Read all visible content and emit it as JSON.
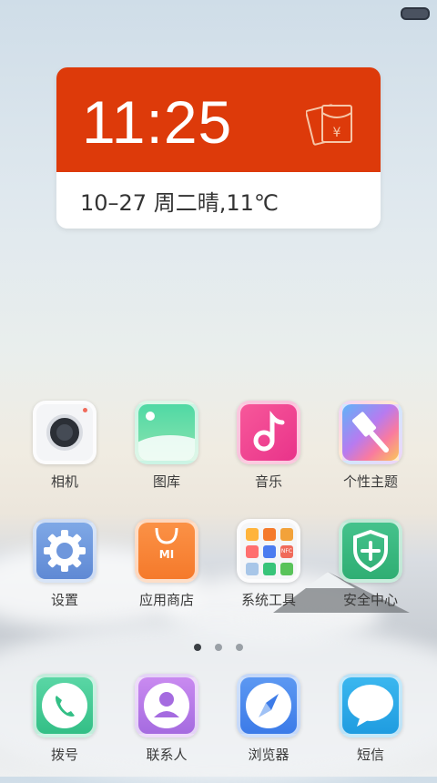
{
  "widget": {
    "time": "11:25",
    "date_weather": "10–27 周二晴,11℃",
    "currency_symbol": "¥"
  },
  "apps_row1": [
    {
      "label": "相机",
      "icon": "camera-icon"
    },
    {
      "label": "图库",
      "icon": "gallery-icon"
    },
    {
      "label": "音乐",
      "icon": "music-icon"
    },
    {
      "label": "个性主题",
      "icon": "theme-brush-icon"
    }
  ],
  "apps_row2": [
    {
      "label": "设置",
      "icon": "gear-icon"
    },
    {
      "label": "应用商店",
      "icon": "app-store-bag-icon",
      "logo_text": "MI"
    },
    {
      "label": "系统工具",
      "icon": "folder-icon",
      "folder_badge": "NFC"
    },
    {
      "label": "安全中心",
      "icon": "shield-plus-icon"
    }
  ],
  "dock": [
    {
      "label": "拨号",
      "icon": "phone-icon"
    },
    {
      "label": "联系人",
      "icon": "contact-icon"
    },
    {
      "label": "浏览器",
      "icon": "compass-icon"
    },
    {
      "label": "短信",
      "icon": "message-bubble-icon"
    }
  ],
  "page_indicator": {
    "pages": 3,
    "current": 1
  },
  "colors": {
    "widget_red": "#dd3a0a",
    "page_dot_active": "#3b3f44"
  }
}
